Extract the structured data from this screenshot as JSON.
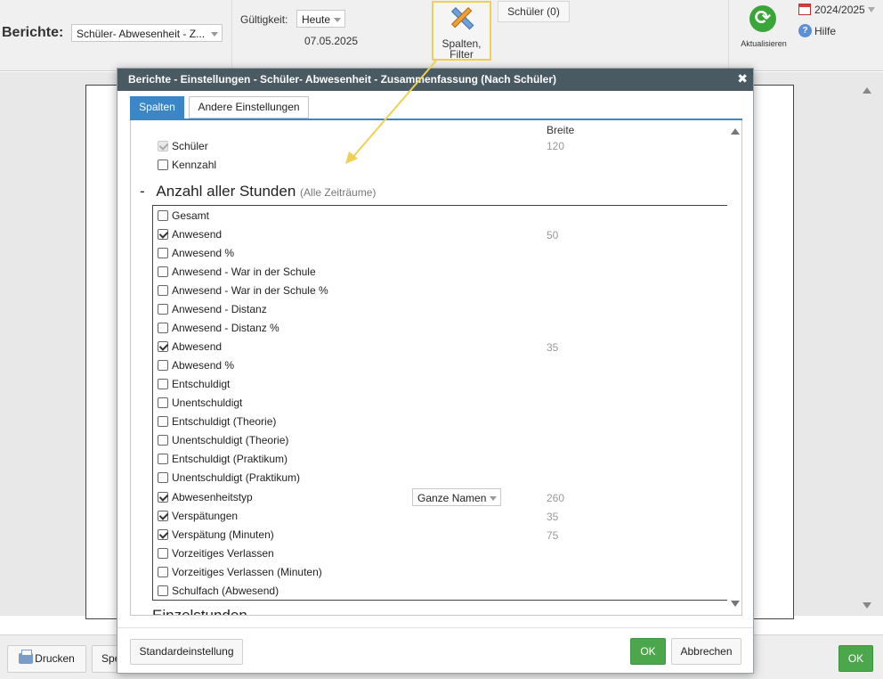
{
  "toolbar": {
    "berichte_label": "Berichte:",
    "report_select": "Schüler- Abwesenheit - Z...",
    "gueltigkeit_label": "Gültigkeit:",
    "gueltigkeit_select": "Heute",
    "date": "07.05.2025",
    "spalten_filter_label_1": "Spalten,",
    "spalten_filter_label_2": "Filter",
    "schueler_button": "Schüler (0)",
    "aktualisieren_label": "Aktualisieren",
    "school_year": "2024/2025",
    "hilfe_label": "Hilfe"
  },
  "bottom": {
    "drucken_label": "Drucken",
    "spe_label": "Spe",
    "ok_label": "OK"
  },
  "modal": {
    "title": "Berichte - Einstellungen - Schüler- Abwesenheit - Zusammenfassung (Nach Schüler)",
    "tabs": [
      "Spalten",
      "Andere Einstellungen"
    ],
    "breite_header": "Breite",
    "top_rows": [
      {
        "label": "Schüler",
        "checked": true,
        "disabled": true,
        "width": "120"
      },
      {
        "label": "Kennzahl",
        "checked": false,
        "disabled": false,
        "width": ""
      }
    ],
    "section_collapse": "-",
    "section_title": "Anzahl aller Stunden",
    "section_subtitle": "(Alle Zeiträume)",
    "rows": [
      {
        "label": "Gesamt",
        "checked": false,
        "width": ""
      },
      {
        "label": "Anwesend",
        "checked": true,
        "width": "50"
      },
      {
        "label": "Anwesend %",
        "checked": false,
        "width": ""
      },
      {
        "label": "Anwesend - War in der Schule",
        "checked": false,
        "width": ""
      },
      {
        "label": "Anwesend - War in der Schule %",
        "checked": false,
        "width": ""
      },
      {
        "label": "Anwesend - Distanz",
        "checked": false,
        "width": ""
      },
      {
        "label": "Anwesend - Distanz %",
        "checked": false,
        "width": ""
      },
      {
        "label": "Abwesend",
        "checked": true,
        "width": "35"
      },
      {
        "label": "Abwesend %",
        "checked": false,
        "width": ""
      },
      {
        "label": "Entschuldigt",
        "checked": false,
        "width": ""
      },
      {
        "label": "Unentschuldigt",
        "checked": false,
        "width": ""
      },
      {
        "label": "Entschuldigt (Theorie)",
        "checked": false,
        "width": ""
      },
      {
        "label": "Unentschuldigt (Theorie)",
        "checked": false,
        "width": ""
      },
      {
        "label": "Entschuldigt (Praktikum)",
        "checked": false,
        "width": ""
      },
      {
        "label": "Unentschuldigt (Praktikum)",
        "checked": false,
        "width": ""
      },
      {
        "label": "Abwesenheitstyp",
        "checked": true,
        "width": "260"
      },
      {
        "label": "Verspätungen",
        "checked": true,
        "width": "35"
      },
      {
        "label": "Verspätung (Minuten)",
        "checked": true,
        "width": "75"
      },
      {
        "label": "Vorzeitiges Verlassen",
        "checked": false,
        "width": ""
      },
      {
        "label": "Vorzeitiges Verlassen (Minuten)",
        "checked": false,
        "width": ""
      },
      {
        "label": "Schulfach (Abwesend)",
        "checked": false,
        "width": ""
      }
    ],
    "abwesenheitstyp_select": "Ganze Namen",
    "cutoff_text": "Einzelstunden",
    "standard_button": "Standardeinstellung",
    "ok_button": "OK",
    "cancel_button": "Abbrechen"
  },
  "colors": {
    "header_bg": "#4a5a62",
    "tab_active": "#3b86c6",
    "ok_green": "#4ca64c",
    "highlight_yellow": "#f0d050"
  }
}
